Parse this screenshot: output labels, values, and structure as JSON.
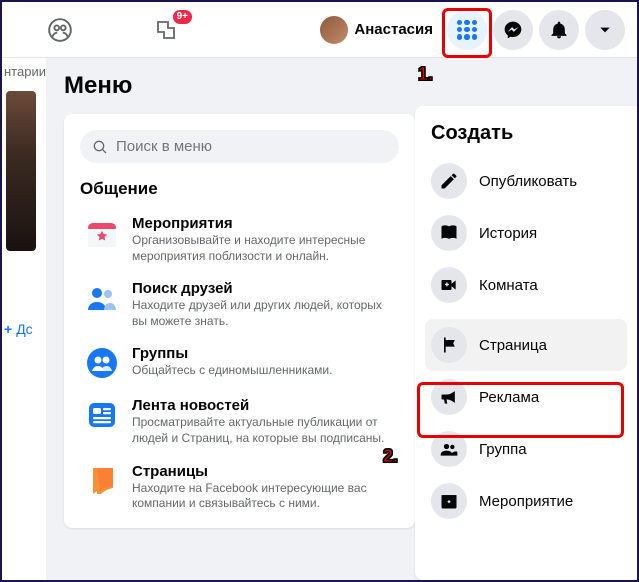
{
  "header": {
    "badge": "9+",
    "profile_name": "Анастасия"
  },
  "left_strip": {
    "truncated": "нтарии",
    "add": "Дс"
  },
  "menu": {
    "heading": "Меню",
    "search_placeholder": "Поиск в меню",
    "section": "Общение",
    "items": [
      {
        "title": "Мероприятия",
        "desc": "Организовывайте и находите интересные мероприятия поблизости и онлайн."
      },
      {
        "title": "Поиск друзей",
        "desc": "Находите друзей или других людей, которых вы можете знать."
      },
      {
        "title": "Группы",
        "desc": "Общайтесь с единомышленниками."
      },
      {
        "title": "Лента новостей",
        "desc": "Просматривайте актуальные публикации от людей и Страниц, на которые вы подписаны."
      },
      {
        "title": "Страницы",
        "desc": "Находите на Facebook интересующие вас компании и связывайтесь с ними."
      }
    ]
  },
  "create": {
    "heading": "Создать",
    "items": [
      {
        "label": "Опубликовать"
      },
      {
        "label": "История"
      },
      {
        "label": "Комната"
      },
      {
        "label": "Страница"
      },
      {
        "label": "Реклама"
      },
      {
        "label": "Группа"
      },
      {
        "label": "Мероприятие"
      }
    ]
  },
  "markers": {
    "one": "1.",
    "two": "2."
  }
}
